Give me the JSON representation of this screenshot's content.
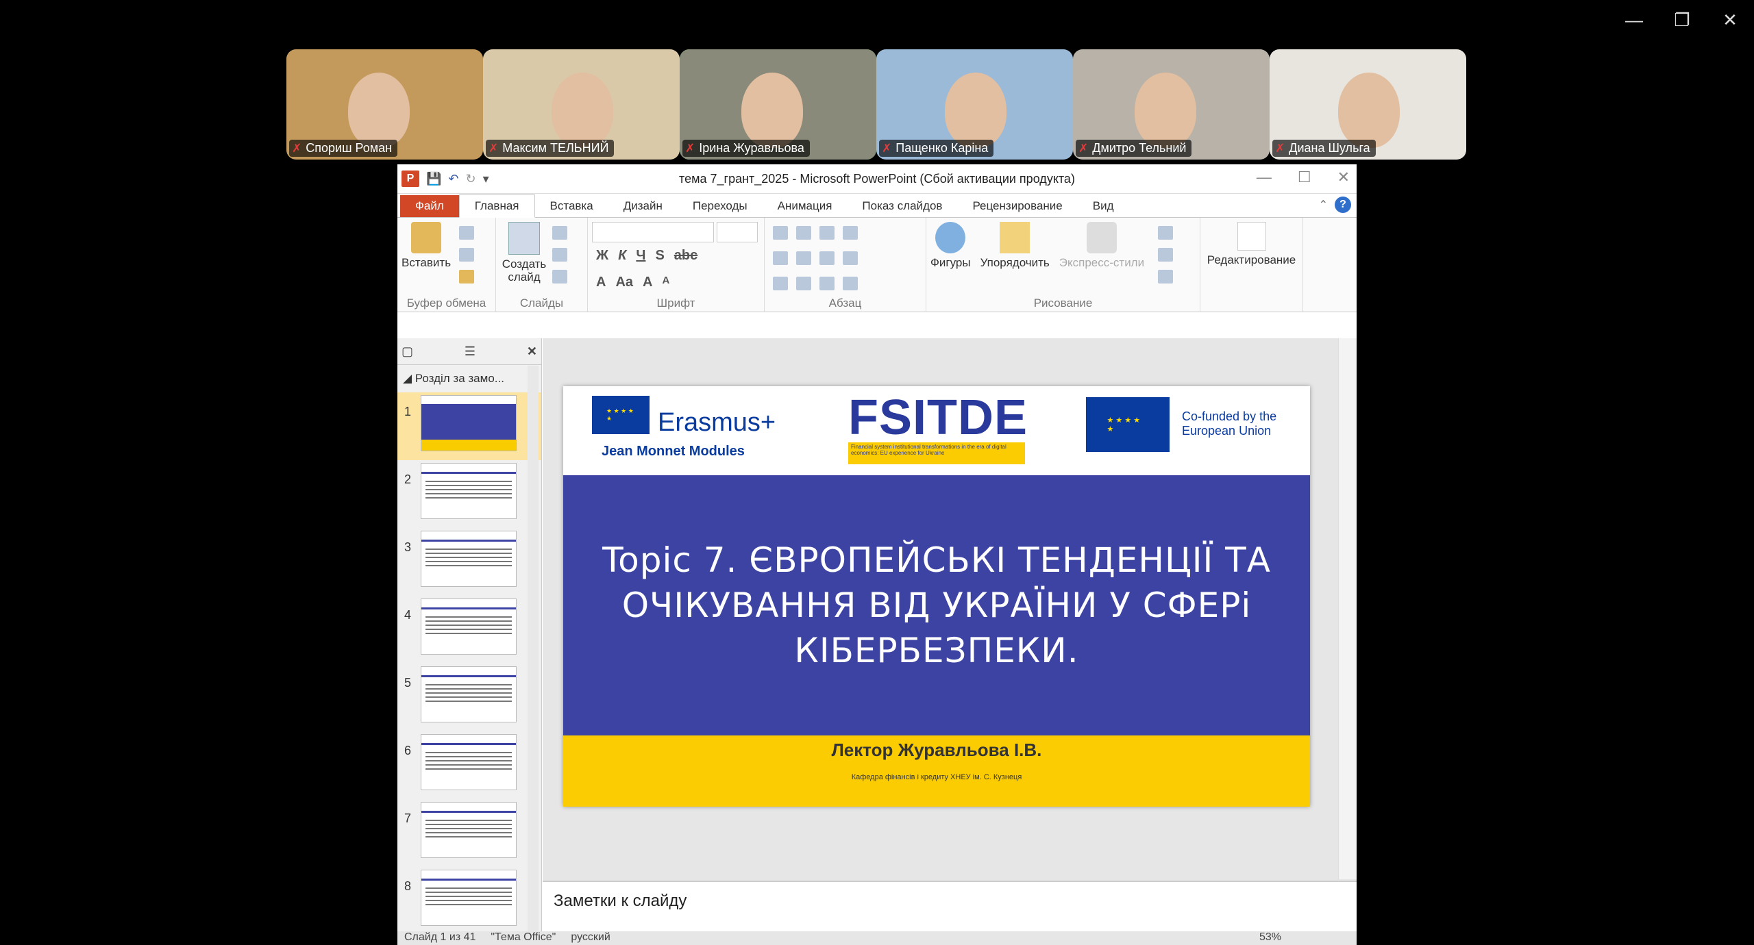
{
  "participants": [
    {
      "name": "Спориш Роман",
      "bg": "#c49a5c",
      "active": false
    },
    {
      "name": "Максим ТЕЛЬНИЙ",
      "bg": "#d9c9a8",
      "active": false
    },
    {
      "name": "Ірина Журавльова",
      "bg": "#8a8a7a",
      "active": true
    },
    {
      "name": "Пащенко Каріна",
      "bg": "#9bbad8",
      "active": false
    },
    {
      "name": "Дмитро Тельний",
      "bg": "#b8b2a8",
      "active": false
    },
    {
      "name": "Диана Шульга",
      "bg": "#e8e4de",
      "active": false
    }
  ],
  "window": {
    "title": "тема 7_грант_2025  -  Microsoft PowerPoint (Сбой активации продукта)"
  },
  "tabs": [
    "Файл",
    "Главная",
    "Вставка",
    "Дизайн",
    "Переходы",
    "Анимация",
    "Показ слайдов",
    "Рецензирование",
    "Вид"
  ],
  "ribbon": {
    "paste": "Вставить",
    "new_slide": "Создать слайд",
    "clipboard": "Буфер обмена",
    "slides": "Слайды",
    "font": "Шрифт",
    "paragraph": "Абзац",
    "shapes": "Фигуры",
    "arrange": "Упорядочить",
    "quick_styles": "Экспресс-стили",
    "drawing": "Рисование",
    "editing": "Редактирование"
  },
  "panel": {
    "section": "Розділ за замо..."
  },
  "slide_numbers": [
    "1",
    "2",
    "3",
    "4",
    "5",
    "6",
    "7",
    "8"
  ],
  "slide": {
    "erasmus": "Erasmus+",
    "erasmus_sub": "Jean Monnet Modules",
    "fsitde": "FSITDE",
    "fsitde_band": "Financial system institutional transformations in the era of digital economics: EU experience for Ukraine",
    "cofunded": "Co-funded by the European Union",
    "title": "Topic 7. ЄВРОПЕЙСЬКІ ТЕНДЕНЦІЇ ТА ОЧІКУВАННЯ ВІД УКРАЇНИ У СФЕРі КІБЕРБЕЗПЕКИ.",
    "lecturer": "Лектор Журавльова І.В.",
    "department": "Кафедра фінансів і кредиту ХНЕУ ім. С. Кузнеця"
  },
  "notes_placeholder": "Заметки к слайду",
  "status": {
    "slide": "Слайд 1 из 41",
    "theme": "\"Тема Office\"",
    "lang": "русский",
    "zoom": "53%"
  }
}
